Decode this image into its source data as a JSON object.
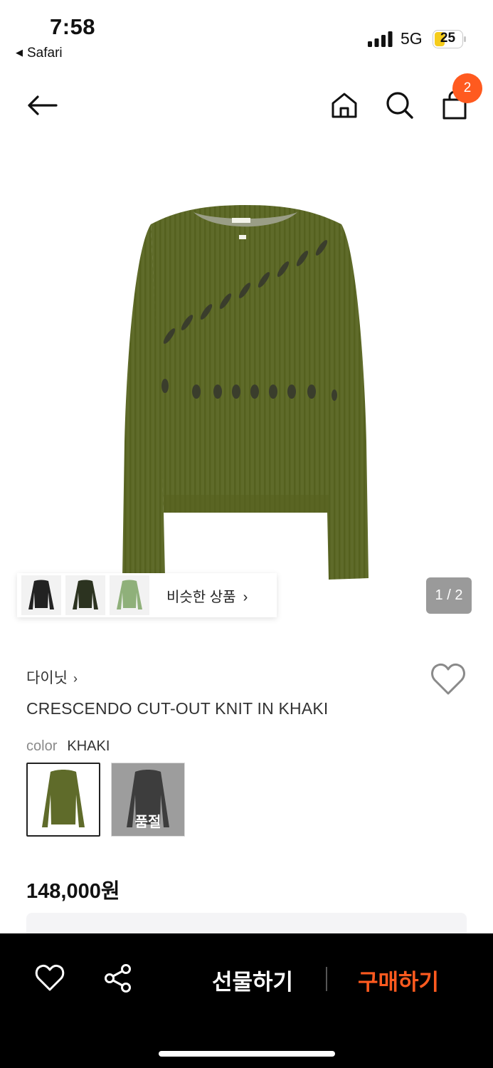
{
  "status_bar": {
    "time": "7:58",
    "back_app": "Safari",
    "network": "5G",
    "battery": "25"
  },
  "nav": {
    "back_icon": "arrow-left-icon",
    "home_icon": "home-icon",
    "search_icon": "search-icon",
    "cart_icon": "shopping-bag-icon",
    "cart_count": "2"
  },
  "gallery": {
    "page_indicator": "1 / 2",
    "similar_label": "비슷한 상품",
    "similar_chevron": "›",
    "similar_thumbs": [
      "black-knit",
      "dark-green-knit",
      "light-green-knit"
    ]
  },
  "product": {
    "brand": "다이닛",
    "brand_chevron": "›",
    "name": "CRESCENDO CUT-OUT KNIT IN KHAKI",
    "color_label": "color",
    "color_value": "KHAKI",
    "options": [
      {
        "name": "khaki",
        "selected": true
      },
      {
        "name": "charcoal",
        "sold_out_label": "품절"
      }
    ],
    "price": "148,000원"
  },
  "bottom_bar": {
    "wishlist_icon": "heart-icon",
    "share_icon": "share-icon",
    "gift_label": "선물하기",
    "buy_label": "구매하기"
  },
  "colors": {
    "accent": "#ff5a1f",
    "knit_khaki": "#5f6b2a",
    "bottom_bar": "#000000"
  }
}
